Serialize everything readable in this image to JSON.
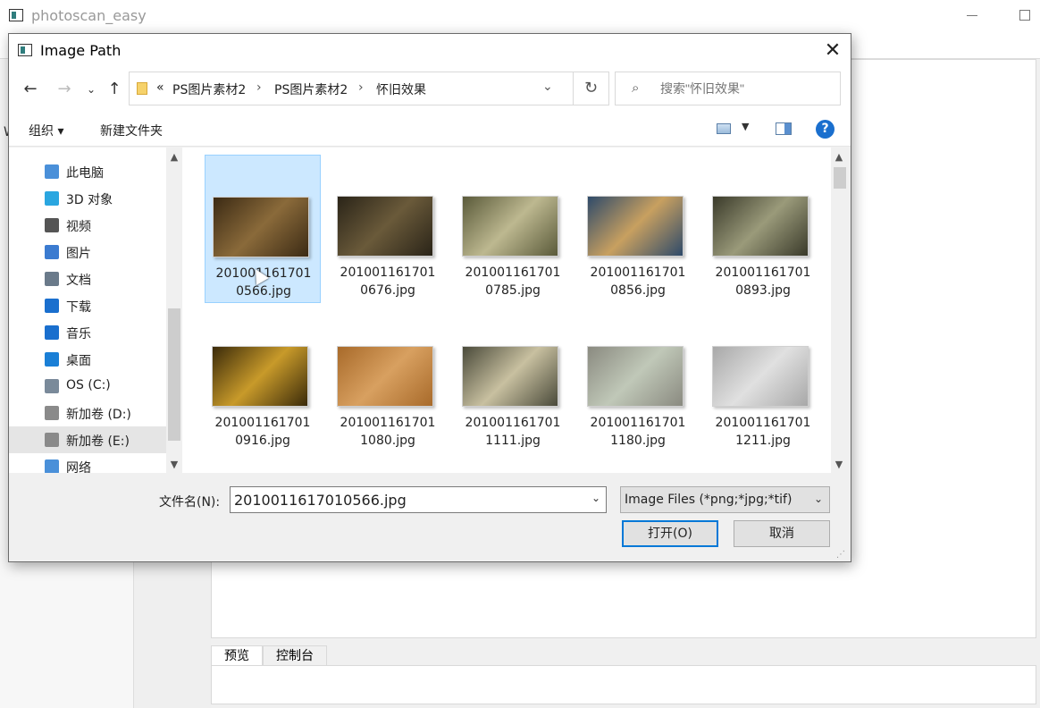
{
  "app": {
    "title": "photoscan_easy",
    "left_letter": "W",
    "bottom_tabs": [
      "预览",
      "控制台"
    ]
  },
  "dialog": {
    "title": "Image Path",
    "close_glyph": "✕",
    "nav": {
      "back": "←",
      "forward": "→",
      "dropdown": "⌄",
      "up": "↑",
      "refresh": "↻"
    },
    "address": {
      "prefix": "«",
      "segments": [
        "PS图片素材2",
        "PS图片素材2",
        "怀旧效果"
      ]
    },
    "search": {
      "placeholder": "搜索\"怀旧效果\""
    },
    "toolbar": {
      "organize": "组织 ▾",
      "new_folder": "新建文件夹",
      "help": "?"
    },
    "nav_items": [
      {
        "label": "此电脑",
        "icon": "computer-icon"
      },
      {
        "label": "3D 对象",
        "icon": "3d-objects-icon"
      },
      {
        "label": "视频",
        "icon": "video-icon"
      },
      {
        "label": "图片",
        "icon": "pictures-icon"
      },
      {
        "label": "文档",
        "icon": "documents-icon"
      },
      {
        "label": "下载",
        "icon": "download-icon"
      },
      {
        "label": "音乐",
        "icon": "music-icon"
      },
      {
        "label": "桌面",
        "icon": "desktop-icon"
      },
      {
        "label": "OS (C:)",
        "icon": "drive-c-icon"
      },
      {
        "label": "新加卷 (D:)",
        "icon": "drive-icon"
      },
      {
        "label": "新加卷 (E:)",
        "icon": "drive-icon",
        "selected": true
      },
      {
        "label": "网络",
        "icon": "network-icon"
      }
    ],
    "files": [
      {
        "line1": "201001161701",
        "line2": "0566.jpg",
        "selected": true,
        "colors": [
          "#3b2a14",
          "#8a6a3a"
        ]
      },
      {
        "line1": "201001161701",
        "line2": "0676.jpg",
        "colors": [
          "#2a2418",
          "#6a5a3a"
        ]
      },
      {
        "line1": "201001161701",
        "line2": "0785.jpg",
        "colors": [
          "#5a5a3a",
          "#bdb890"
        ]
      },
      {
        "line1": "201001161701",
        "line2": "0856.jpg",
        "colors": [
          "#2e4a6a",
          "#c8a060"
        ]
      },
      {
        "line1": "201001161701",
        "line2": "0893.jpg",
        "colors": [
          "#3a3a2a",
          "#9a9a7a"
        ]
      },
      {
        "line1": "201001161701",
        "line2": "0916.jpg",
        "colors": [
          "#3a2a0a",
          "#c89a2a"
        ]
      },
      {
        "line1": "201001161701",
        "line2": "1080.jpg",
        "colors": [
          "#a86a2a",
          "#d8a060"
        ]
      },
      {
        "line1": "201001161701",
        "line2": "1111.jpg",
        "colors": [
          "#4a4a3a",
          "#c8c0a0"
        ]
      },
      {
        "line1": "201001161701",
        "line2": "1180.jpg",
        "colors": [
          "#8a8a80",
          "#c0c8b8"
        ]
      },
      {
        "line1": "201001161701",
        "line2": "1211.jpg",
        "colors": [
          "#a8a8a8",
          "#e0e0e0"
        ]
      }
    ],
    "filename_label": "文件名(N):",
    "filename_value": "2010011617010566.jpg",
    "filetype_value": "Image Files (*png;*jpg;*tif)",
    "open_button": "打开(O)",
    "cancel_button": "取消"
  }
}
